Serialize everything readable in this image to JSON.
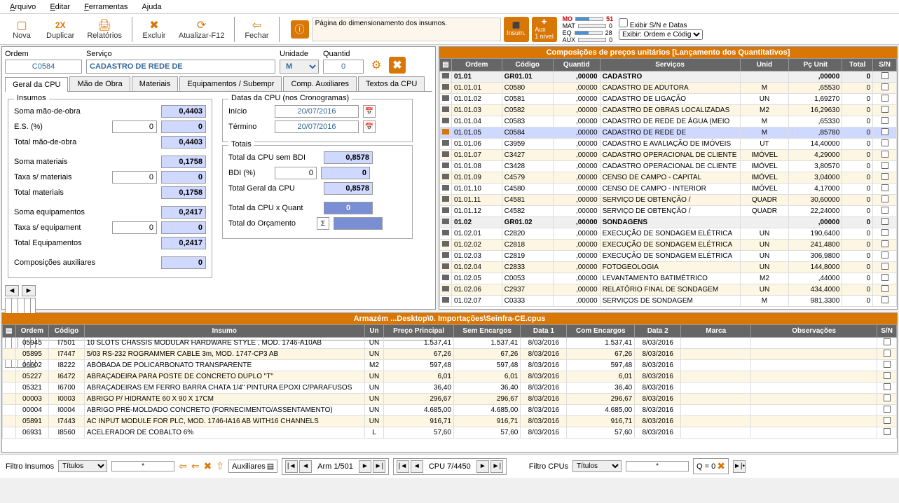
{
  "menu": {
    "arquivo": "Arquivo",
    "editar": "Editar",
    "ferramentas": "Ferramentas",
    "ajuda": "Ajuda"
  },
  "toolbar": {
    "nova": "Nova",
    "duplicar": "Duplicar",
    "relatorios": "Relatórios",
    "excluir": "Excluir",
    "atualizar": "Atualizar-F12",
    "fechar": "Fechar"
  },
  "info": {
    "text": "Página do dimensionamento dos insumos.",
    "insum": "Insum.",
    "aux": "Aux\n1 nível"
  },
  "meters": {
    "mo_lbl": "MO",
    "mo_val": "51",
    "mat_lbl": "MAT",
    "mat_val": "0",
    "eq_lbl": "EQ",
    "eq_val": "28",
    "aux_lbl": "AUX",
    "aux_val": "0"
  },
  "right_ctrl": {
    "checkbox": "Exibir S/N e Datas",
    "select": "Exibir: Ordem e Código"
  },
  "header": {
    "ordem_lbl": "Ordem",
    "ordem": "C0584",
    "servico_lbl": "Serviço",
    "servico": "CADASTRO DE REDE DE",
    "unidade_lbl": "Unidade",
    "unidade": "M",
    "quant_lbl": "Quantid",
    "quant": "0"
  },
  "tabs": {
    "geral": "Geral da CPU",
    "mao": "Mão de Obra",
    "mat": "Materiais",
    "equip": "Equipamentos / Subempr",
    "comp": "Comp. Auxiliares",
    "textos": "Textos da CPU"
  },
  "insumos": {
    "title": "Insumos",
    "soma_mao_lbl": "Soma mão-de-obra",
    "soma_mao": "0,4403",
    "es_lbl": "E.S. (%)",
    "es_pct": "0",
    "es_val": "0",
    "total_mao_lbl": "Total mão-de-obra",
    "total_mao": "0,4403",
    "soma_mat_lbl": "Soma materiais",
    "soma_mat": "0,1758",
    "taxa_mat_lbl": "Taxa s/ materiais",
    "taxa_mat_pct": "0",
    "taxa_mat_val": "0",
    "total_mat_lbl": "Total materiais",
    "total_mat": "0,1758",
    "soma_eq_lbl": "Soma equipamentos",
    "soma_eq": "0,2417",
    "taxa_eq_lbl": "Taxa s/ equipament",
    "taxa_eq_pct": "0",
    "taxa_eq_val": "0",
    "total_eq_lbl": "Total Equipamentos",
    "total_eq": "0,2417",
    "comp_aux_lbl": "Composições auxiliares",
    "comp_aux": "0"
  },
  "datas": {
    "title": "Datas da CPU (nos Cronogramas)",
    "inicio_lbl": "Início",
    "inicio": "20/07/2016",
    "termino_lbl": "Término",
    "termino": "20/07/2016"
  },
  "totais": {
    "title": "Totais",
    "sem_bdi_lbl": "Total da CPU sem BDI",
    "sem_bdi": "0,8578",
    "bdi_lbl": "BDI (%)",
    "bdi_pct": "0",
    "bdi_val": "0",
    "geral_lbl": "Total Geral da CPU",
    "geral": "0,8578",
    "quant_lbl": "Total da CPU x Quant",
    "quant": "0",
    "orcamento_lbl": "Total do Orçamento"
  },
  "rp": {
    "title": "Composições de preços unitários [Lançamento dos Quantitativos]",
    "cols": {
      "ordem": "Ordem",
      "codigo": "Código",
      "quant": "Quantid",
      "servicos": "Serviços",
      "unid": "Unid",
      "pcunit": "Pç Unit",
      "total": "Total",
      "sn": "S/N"
    },
    "rows": [
      {
        "g": true,
        "ordem": "01.01",
        "codigo": "GR01.01",
        "quant": ",00000",
        "serv": "CADASTRO",
        "unid": "",
        "pc": ",00000",
        "tot": "0"
      },
      {
        "ordem": "01.01.01",
        "codigo": "C0580",
        "quant": ",00000",
        "serv": "CADASTRO DE ADUTORA",
        "unid": "M",
        "pc": ",65530",
        "tot": "0"
      },
      {
        "ordem": "01.01.02",
        "codigo": "C0581",
        "quant": ",00000",
        "serv": "CADASTRO DE LIGAÇÃO",
        "unid": "UN",
        "pc": "1,69270",
        "tot": "0"
      },
      {
        "ordem": "01.01.03",
        "codigo": "C0582",
        "quant": ",00000",
        "serv": "CADASTRO DE OBRAS LOCALIZADAS",
        "unid": "M2",
        "pc": "16,29630",
        "tot": "0"
      },
      {
        "ordem": "01.01.04",
        "codigo": "C0583",
        "quant": ",00000",
        "serv": "CADASTRO DE REDE DE ÁGUA (MEIO",
        "unid": "M",
        "pc": ",65330",
        "tot": "0"
      },
      {
        "sel": true,
        "ordem": "01.01.05",
        "codigo": "C0584",
        "quant": ",00000",
        "serv": "CADASTRO DE REDE DE",
        "unid": "M",
        "pc": ",85780",
        "tot": "0"
      },
      {
        "ordem": "01.01.06",
        "codigo": "C3959",
        "quant": ",00000",
        "serv": "CADASTRO E AVALIAÇÃO DE IMÓVEIS",
        "unid": "UT",
        "pc": "14,40000",
        "tot": "0"
      },
      {
        "ordem": "01.01.07",
        "codigo": "C3427",
        "quant": ",00000",
        "serv": "CADASTRO OPERACIONAL DE CLIENTE",
        "unid": "IMÓVEL",
        "pc": "4,29000",
        "tot": "0"
      },
      {
        "ordem": "01.01.08",
        "codigo": "C3428",
        "quant": ",00000",
        "serv": "CADASTRO OPERACIONAL DE CLIENTE",
        "unid": "IMÓVEL",
        "pc": "3,80570",
        "tot": "0"
      },
      {
        "ordem": "01.01.09",
        "codigo": "C4579",
        "quant": ",00000",
        "serv": "CENSO DE CAMPO - CAPITAL",
        "unid": "IMÓVEL",
        "pc": "3,04000",
        "tot": "0"
      },
      {
        "ordem": "01.01.10",
        "codigo": "C4580",
        "quant": ",00000",
        "serv": "CENSO DE CAMPO - INTERIOR",
        "unid": "IMÓVEL",
        "pc": "4,17000",
        "tot": "0"
      },
      {
        "ordem": "01.01.11",
        "codigo": "C4581",
        "quant": ",00000",
        "serv": "SERVIÇO DE OBTENÇÃO /",
        "unid": "QUADR",
        "pc": "30,60000",
        "tot": "0"
      },
      {
        "ordem": "01.01.12",
        "codigo": "C4582",
        "quant": ",00000",
        "serv": "SERVIÇO DE OBTENÇÃO /",
        "unid": "QUADR",
        "pc": "22,24000",
        "tot": "0"
      },
      {
        "g": true,
        "ordem": "01.02",
        "codigo": "GR01.02",
        "quant": ",00000",
        "serv": "SONDAGENS",
        "unid": "",
        "pc": ",00000",
        "tot": "0"
      },
      {
        "ordem": "01.02.01",
        "codigo": "C2820",
        "quant": ",00000",
        "serv": "EXECUÇÃO DE SONDAGEM ELÉTRICA",
        "unid": "UN",
        "pc": "190,6400",
        "tot": "0"
      },
      {
        "ordem": "01.02.02",
        "codigo": "C2818",
        "quant": ",00000",
        "serv": "EXECUÇÃO DE SONDAGEM ELÉTRICA",
        "unid": "UN",
        "pc": "241,4800",
        "tot": "0"
      },
      {
        "ordem": "01.02.03",
        "codigo": "C2819",
        "quant": ",00000",
        "serv": "EXECUÇÃO DE SONDAGEM ELÉTRICA",
        "unid": "UN",
        "pc": "306,9800",
        "tot": "0"
      },
      {
        "ordem": "01.02.04",
        "codigo": "C2833",
        "quant": ",00000",
        "serv": "FOTOGEOLOGIA",
        "unid": "UN",
        "pc": "144,8000",
        "tot": "0"
      },
      {
        "ordem": "01.02.05",
        "codigo": "C0053",
        "quant": ",00000",
        "serv": "LEVANTAMENTO BATIMÉTRICO",
        "unid": "M2",
        "pc": ",44000",
        "tot": "0"
      },
      {
        "ordem": "01.02.06",
        "codigo": "C2937",
        "quant": ",00000",
        "serv": "RELATÓRIO FINAL DE SONDAGEM",
        "unid": "UN",
        "pc": "434,4000",
        "tot": "0"
      },
      {
        "ordem": "01.02.07",
        "codigo": "C0333",
        "quant": ",00000",
        "serv": "SERVIÇOS DE SONDAGEM",
        "unid": "M",
        "pc": "981,3300",
        "tot": "0"
      }
    ]
  },
  "bt": {
    "title": "Armazém ...Desktop\\0. Importações\\Seinfra-CE.cpus",
    "cols": {
      "ordem": "Ordem",
      "codigo": "Código",
      "insumo": "Insumo",
      "un": "Un",
      "preco": "Preço Principal",
      "sem": "Sem Encargos",
      "d1": "Data 1",
      "com": "Com Encargos",
      "d2": "Data 2",
      "marca": "Marca",
      "obs": "Observações",
      "sn": "S/N"
    },
    "rows": [
      {
        "sel": true,
        "ordem": "05945",
        "codigo": "I7501",
        "ins": "10 SLOTS CHASSIS MODULAR HARDWARE STYLE , MOD. 1746-A10AB",
        "un": "UN",
        "p": "1.537,41",
        "s": "1.537,41",
        "d1": "8/03/2016",
        "c": "1.537,41",
        "d2": "8/03/2016"
      },
      {
        "ordem": "05895",
        "codigo": "I7447",
        "ins": "5/03 RS-232 ROGRAMMER CABLE 3m, MOD. 1747-CP3 AB",
        "un": "UN",
        "p": "67,26",
        "s": "67,26",
        "d1": "8/03/2016",
        "c": "67,26",
        "d2": "8/03/2016"
      },
      {
        "ordem": "06602",
        "codigo": "I8222",
        "ins": "ABÓBADA DE POLICARBONATO TRANSPARENTE",
        "un": "M2",
        "p": "597,48",
        "s": "597,48",
        "d1": "8/03/2016",
        "c": "597,48",
        "d2": "8/03/2016"
      },
      {
        "ordem": "05227",
        "codigo": "I6472",
        "ins": "ABRAÇADEIRA PARA POSTE DE CONCRETO DUPLO \"T\"",
        "un": "UN",
        "p": "6,01",
        "s": "6,01",
        "d1": "8/03/2016",
        "c": "6,01",
        "d2": "8/03/2016"
      },
      {
        "ordem": "05321",
        "codigo": "I6700",
        "ins": "ABRAÇADEIRAS EM FERRO BARRA CHATA 1/4\" PINTURA EPOXI C/PARAFUSOS",
        "un": "UN",
        "p": "36,40",
        "s": "36,40",
        "d1": "8/03/2016",
        "c": "36,40",
        "d2": "8/03/2016"
      },
      {
        "ordem": "00003",
        "codigo": "I0003",
        "ins": "ABRIGO P/ HIDRANTE 60 X 90 X 17CM",
        "un": "UN",
        "p": "296,67",
        "s": "296,67",
        "d1": "8/03/2016",
        "c": "296,67",
        "d2": "8/03/2016"
      },
      {
        "ordem": "00004",
        "codigo": "I0004",
        "ins": "ABRIGO PRÉ-MOLDADO CONCRETO (FORNECIMENTO/ASSENTAMENTO)",
        "un": "UN",
        "p": "4.685,00",
        "s": "4.685,00",
        "d1": "8/03/2016",
        "c": "4.685,00",
        "d2": "8/03/2016"
      },
      {
        "ordem": "05891",
        "codigo": "I7443",
        "ins": "AC INPUT MODULE FOR PLC, MOD. 1746-IA16 AB WITH16 CHANNELS",
        "un": "UN",
        "p": "916,71",
        "s": "916,71",
        "d1": "8/03/2016",
        "c": "916,71",
        "d2": "8/03/2016"
      },
      {
        "ordem": "06931",
        "codigo": "I8560",
        "ins": "ACELERADOR DE COBALTO 6%",
        "un": "L",
        "p": "57,60",
        "s": "57,60",
        "d1": "8/03/2016",
        "c": "57,60",
        "d2": "8/03/2016"
      }
    ]
  },
  "footer": {
    "filtro_ins_lbl": "Filtro Insumos",
    "titulos": "Títulos",
    "star": "*",
    "aux_lbl": "Auxiliares",
    "arm": "Arm 1/501",
    "cpu": "CPU 7/4450",
    "filtro_cpu_lbl": "Filtro CPUs",
    "q0": "Q = 0"
  }
}
